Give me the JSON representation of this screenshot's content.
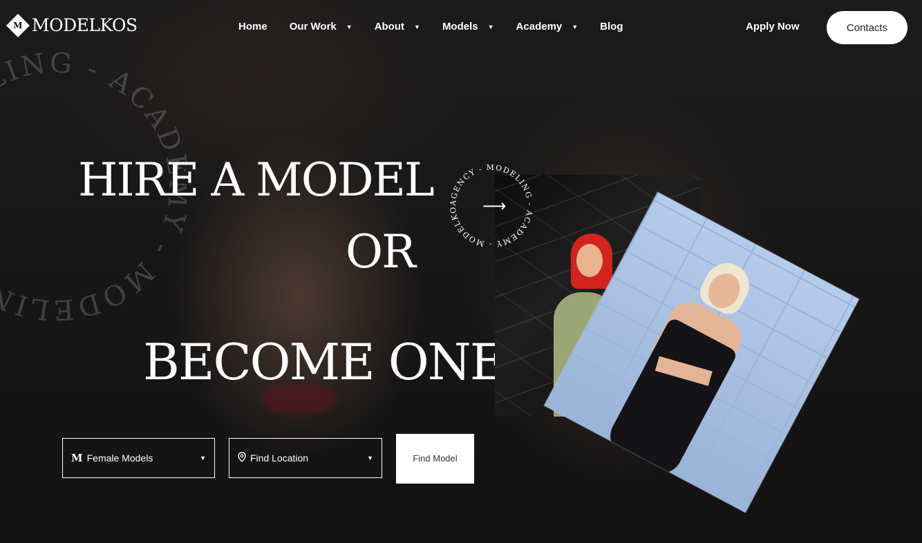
{
  "brand": {
    "name": "MODELKOS",
    "mark": "M"
  },
  "nav": {
    "items": [
      {
        "label": "Home",
        "dropdown": false
      },
      {
        "label": "Our Work",
        "dropdown": true
      },
      {
        "label": "About",
        "dropdown": true
      },
      {
        "label": "Models",
        "dropdown": true
      },
      {
        "label": "Academy",
        "dropdown": true
      },
      {
        "label": "Blog",
        "dropdown": false
      }
    ],
    "apply_label": "Apply Now",
    "contacts_label": "Contacts"
  },
  "hero": {
    "line1": "HIRE A MODEL",
    "line2": "OR",
    "line3": "BECOME ONE",
    "ring_text": "AGENCY - MODELING - ACADEMY - MODELKOS - ",
    "big_ring_text": "MODELING - ACADEMY - MODELING - ACADEMY - "
  },
  "search": {
    "category_value": "Female Models",
    "category_icon": "modelkos-m-icon",
    "location_value": "Find Location",
    "location_icon": "map-pin-icon",
    "find_button_label": "Find Model"
  },
  "colors": {
    "background": "#161616",
    "text": "#ffffff",
    "button_bg": "#ffffff"
  }
}
